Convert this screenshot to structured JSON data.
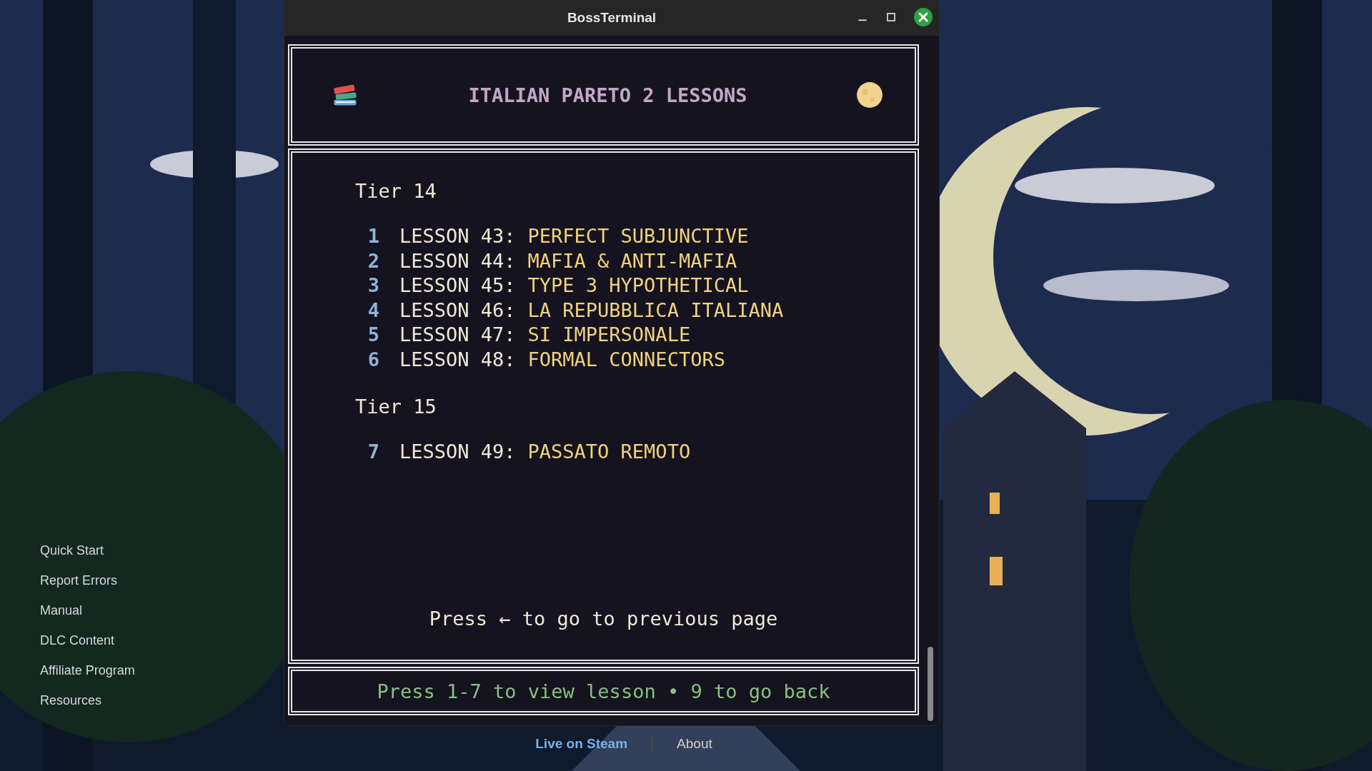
{
  "window": {
    "title": "BossTerminal"
  },
  "header": {
    "title": "ITALIAN PARETO 2 LESSONS"
  },
  "tiers": [
    {
      "label": "Tier 14",
      "lessons": [
        {
          "key": "1",
          "lesson": "LESSON 43:",
          "title": "PERFECT SUBJUNCTIVE"
        },
        {
          "key": "2",
          "lesson": "LESSON 44:",
          "title": "MAFIA & ANTI-MAFIA"
        },
        {
          "key": "3",
          "lesson": "LESSON 45:",
          "title": "TYPE 3 HYPOTHETICAL"
        },
        {
          "key": "4",
          "lesson": "LESSON 46:",
          "title": "LA REPUBBLICA ITALIANA"
        },
        {
          "key": "5",
          "lesson": "LESSON 47:",
          "title": "SI IMPERSONALE"
        },
        {
          "key": "6",
          "lesson": "LESSON 48:",
          "title": "FORMAL CONNECTORS"
        }
      ]
    },
    {
      "label": "Tier 15",
      "lessons": [
        {
          "key": "7",
          "lesson": "LESSON 49:",
          "title": "PASSATO REMOTO"
        }
      ]
    }
  ],
  "hint": "Press ← to go to previous page",
  "status_bar": "Press 1-7 to view lesson • 9 to go back",
  "sidebar": {
    "items": [
      "Quick Start",
      "Report Errors",
      "Manual",
      "DLC Content",
      "Affiliate Program",
      "Resources"
    ]
  },
  "footer": {
    "links": [
      {
        "label": "Live on Steam",
        "kind": "highlight"
      },
      {
        "label": "About",
        "kind": "plain"
      }
    ]
  }
}
